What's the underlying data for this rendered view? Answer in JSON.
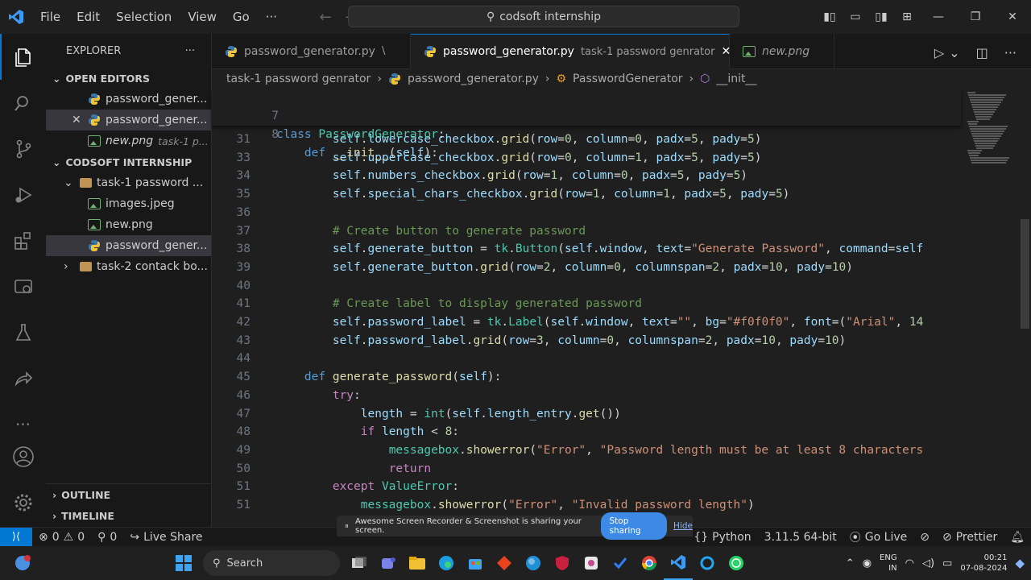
{
  "menu": [
    "File",
    "Edit",
    "Selection",
    "View",
    "Go",
    "···"
  ],
  "search": {
    "text": "codsoft internship"
  },
  "explorer": {
    "title": "EXPLORER",
    "open_editors_label": "OPEN EDITORS",
    "open_editors": [
      {
        "name": "password_gener...",
        "desc": ""
      },
      {
        "name": "password_gener...",
        "desc": ""
      },
      {
        "name": "new.png",
        "desc": "task-1 p..."
      }
    ],
    "workspace_label": "CODSOFT INTERNSHIP",
    "tree": [
      {
        "name": "task-1 password ...",
        "type": "folder"
      },
      {
        "name": "images.jpeg",
        "type": "image"
      },
      {
        "name": "new.png",
        "type": "image"
      },
      {
        "name": "password_gener...",
        "type": "python"
      },
      {
        "name": "task-2 contack bo...",
        "type": "folder"
      }
    ],
    "outline_label": "OUTLINE",
    "timeline_label": "TIMELINE"
  },
  "tabs": [
    {
      "name": "password_generator.py",
      "desc": "\\"
    },
    {
      "name": "password_generator.py",
      "desc": "task-1 password genrator"
    },
    {
      "name": "new.png",
      "desc": ""
    }
  ],
  "breadcrumb": [
    "task-1 password genrator",
    "password_generator.py",
    "PasswordGenerator",
    "__init__"
  ],
  "sticky": [
    {
      "ln": "7",
      "code": "class PasswordGenerator:"
    },
    {
      "ln": "8",
      "code": "    def __init__(self):"
    }
  ],
  "code_lines": [
    {
      "ln": "31",
      "code": "        self.lowercase_checkbox.grid(row=0, column=0, padx=5, pady=5)"
    },
    {
      "ln": "33",
      "code": "        self.uppercase_checkbox.grid(row=0, column=1, padx=5, pady=5)"
    },
    {
      "ln": "34",
      "code": "        self.numbers_checkbox.grid(row=1, column=0, padx=5, pady=5)"
    },
    {
      "ln": "35",
      "code": "        self.special_chars_checkbox.grid(row=1, column=1, padx=5, pady=5)"
    },
    {
      "ln": "36",
      "code": ""
    },
    {
      "ln": "37",
      "code": "        # Create button to generate password"
    },
    {
      "ln": "38",
      "code": "        self.generate_button = tk.Button(self.window, text=\"Generate Password\", command=self"
    },
    {
      "ln": "39",
      "code": "        self.generate_button.grid(row=2, column=0, columnspan=2, padx=10, pady=10)"
    },
    {
      "ln": "40",
      "code": ""
    },
    {
      "ln": "41",
      "code": "        # Create label to display generated password"
    },
    {
      "ln": "42",
      "code": "        self.password_label = tk.Label(self.window, text=\"\", bg=\"#f0f0f0\", font=(\"Arial\", 14"
    },
    {
      "ln": "43",
      "code": "        self.password_label.grid(row=3, column=0, columnspan=2, padx=10, pady=10)"
    },
    {
      "ln": "44",
      "code": ""
    },
    {
      "ln": "45",
      "code": "    def generate_password(self):"
    },
    {
      "ln": "46",
      "code": "        try:"
    },
    {
      "ln": "47",
      "code": "            length = int(self.length_entry.get())"
    },
    {
      "ln": "48",
      "code": "            if length < 8:"
    },
    {
      "ln": "49",
      "code": "                messagebox.showerror(\"Error\", \"Password length must be at least 8 characters"
    },
    {
      "ln": "50",
      "code": "                return"
    },
    {
      "ln": "51",
      "code": "        except ValueError:"
    },
    {
      "ln": "51",
      "code": "            messagebox.showerror(\"Error\", \"Invalid password length\")"
    }
  ],
  "share_bar": {
    "text": "Awesome Screen Recorder & Screenshot is sharing your screen.",
    "stop": "Stop sharing",
    "hide": "Hide"
  },
  "status": {
    "errors": "0",
    "warnings": "0",
    "ports": "0",
    "live_share": "Live Share",
    "language": "Python",
    "interpreter": "3.11.5 64-bit",
    "go_live": "Go Live",
    "prettier": "Prettier"
  },
  "taskbar": {
    "search": "Search",
    "lang": "ENG",
    "region": "IN",
    "time": "00:21",
    "date": "07-08-2024"
  }
}
